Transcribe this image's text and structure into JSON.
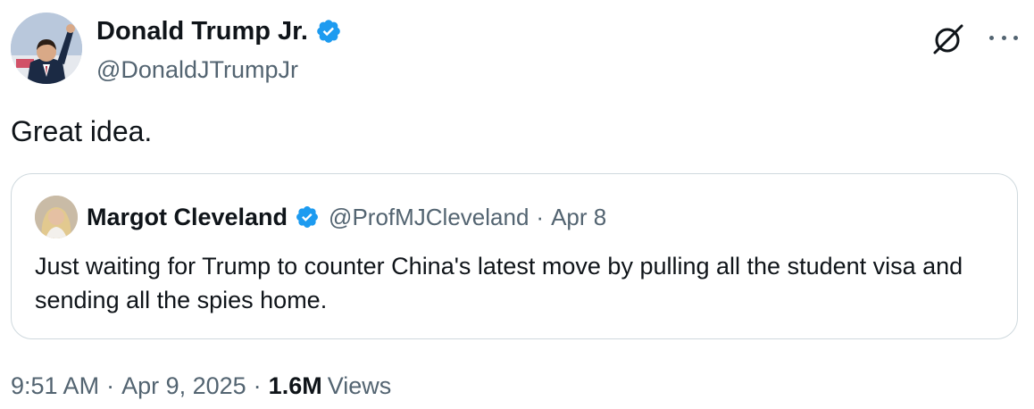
{
  "author": {
    "display_name": "Donald Trump Jr.",
    "handle": "@DonaldJTrumpJr",
    "verified_color": "#1d9bf0"
  },
  "tweet": {
    "text": "Great idea."
  },
  "quoted": {
    "display_name": "Margot Cleveland",
    "handle": "@ProfMJCleveland",
    "separator": "·",
    "date": "Apr 8",
    "text": "Just waiting for Trump to counter China's latest move by pulling all the student visa and sending all the spies home."
  },
  "meta": {
    "time": "9:51 AM",
    "separator": "·",
    "date": "Apr 9, 2025",
    "views_count": "1.6M",
    "views_label": "Views"
  },
  "icons": {
    "grok": "grok-icon",
    "more": "more-icon",
    "verified": "verified-badge-icon"
  },
  "colors": {
    "text_primary": "#0f1419",
    "text_secondary": "#536471",
    "border": "#cfd9de",
    "accent": "#1d9bf0"
  }
}
